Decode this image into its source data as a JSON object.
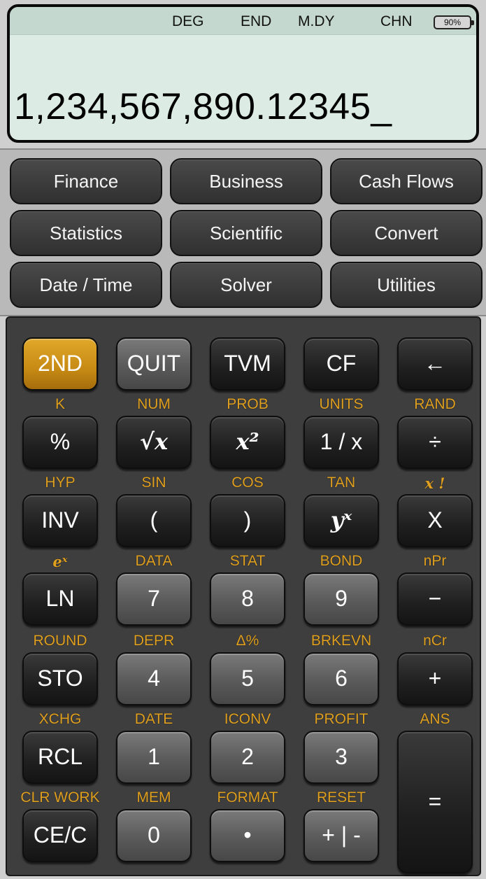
{
  "status": {
    "angle_mode": "DEG",
    "payment_mode": "END",
    "date_format": "M.DY",
    "language": "CHN",
    "battery": "90%"
  },
  "display": {
    "value": "1,234,567,890.12345_"
  },
  "menu": {
    "row1": [
      "Finance",
      "Business",
      "Cash Flows"
    ],
    "row2": [
      "Statistics",
      "Scientific",
      "Convert"
    ],
    "row3": [
      "Date / Time",
      "Solver",
      "Utilities"
    ]
  },
  "keys": {
    "row1": [
      "2ND",
      "QUIT",
      "TVM",
      "CF",
      "←"
    ],
    "row2_second": [
      "K",
      "NUM",
      "PROB",
      "UNITS",
      "RAND"
    ],
    "row2": [
      "%",
      "√x",
      "x²",
      "1 / x",
      "÷"
    ],
    "row3_second": [
      "HYP",
      "SIN",
      "COS",
      "TAN",
      "x !"
    ],
    "row3": [
      "INV",
      "(",
      ")",
      "yˣ",
      "X"
    ],
    "row4_second": [
      "eˣ",
      "DATA",
      "STAT",
      "BOND",
      "nPr"
    ],
    "row4": [
      "LN",
      "7",
      "8",
      "9",
      "−"
    ],
    "row5_second": [
      "ROUND",
      "DEPR",
      "Δ%",
      "BRKEVN",
      "nCr"
    ],
    "row5": [
      "STO",
      "4",
      "5",
      "6",
      "+"
    ],
    "row6_second": [
      "XCHG",
      "DATE",
      "ICONV",
      "PROFIT",
      "ANS"
    ],
    "row6": [
      "RCL",
      "1",
      "2",
      "3",
      "="
    ],
    "row7_second": [
      "CLR WORK",
      "MEM",
      "FORMAT",
      "RESET"
    ],
    "row7": [
      "CE/C",
      "0",
      "•",
      "+ | -"
    ]
  },
  "colors": {
    "display_bg": "#dcebe4",
    "second_label": "#e0a020",
    "second_key": "#c78a14"
  }
}
